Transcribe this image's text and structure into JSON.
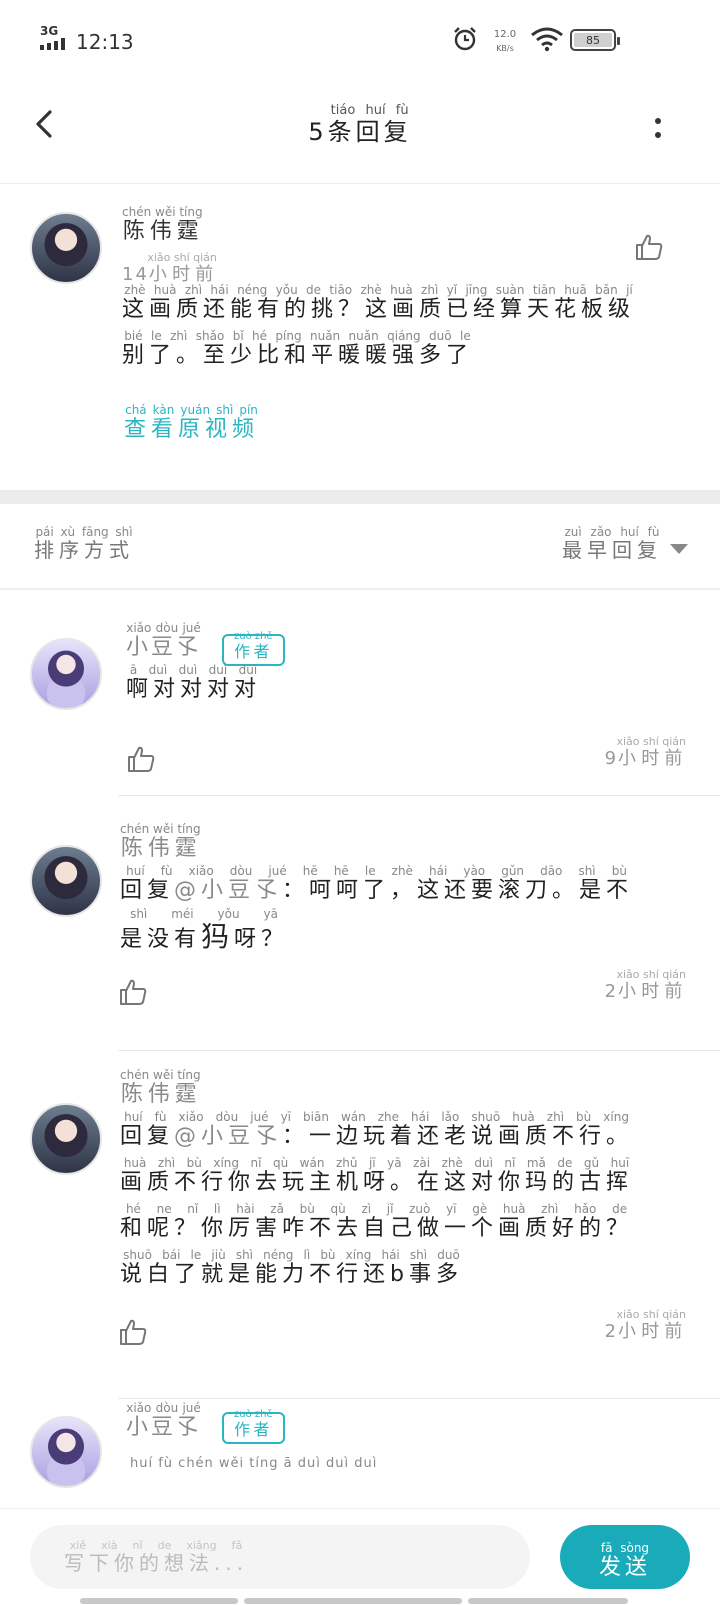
{
  "status_bar": {
    "network": "3G",
    "time": "12:13",
    "speed_value": "12.0",
    "speed_unit": "KB/s",
    "battery": "85"
  },
  "header": {
    "title_num": "5",
    "title_pinyin": "tiáo huí fù",
    "title_text": "条回复"
  },
  "main_comment": {
    "user_pinyin": "chén wěi tíng",
    "user_name": "陈伟霆",
    "time_pinyin": "xiǎo shí qián",
    "time_num": "14",
    "time_text": "小时前",
    "text_lines": [
      {
        "pinyin": "zhè huà zhì hái néng yǒu de tiāo    zhè huà zhì yǐ jīng suàn tiān huā bǎn jí",
        "text": "这画质还能有的挑？这画质已经算天花板级"
      },
      {
        "pinyin": "bié le    zhì shǎo bǐ hé píng nuǎn nuǎn qiáng duō le",
        "text": "别了。至少比和平暖暖强多了"
      }
    ],
    "view_video_pinyin": "chá kàn yuán shì pín",
    "view_video_text": "查看原视频"
  },
  "sort": {
    "label_pinyin": "pái xù fāng shì",
    "label_text": "排序方式",
    "value_pinyin": "zuì zǎo huí fù",
    "value_text": "最早回复"
  },
  "replies": [
    {
      "user_pinyin": "xiǎo dòu jué",
      "user_name": "小豆孓",
      "badge_pinyin": "zuò zhě",
      "badge_text": "作者",
      "line1_pinyin": "ā duì duì duì duì",
      "line1_text": "啊对对对对",
      "time_pinyin": "xiǎo shí qián",
      "time_num": "9",
      "time_text": "小时前"
    },
    {
      "user_pinyin": "chén wěi tíng",
      "user_name": "陈伟霆",
      "line1_pinyin": "huí fù    xiǎo dòu jué      hē hē le      zhè hái yào gǔn dāo      shì bù",
      "line1_prefix": "回复",
      "line1_mention": "@小豆孓",
      "line1_text": "：呵呵了，这还要滚刀。是不",
      "line2_pinyin": "shì méi yǒu      yā",
      "line2_text_a": "是没有",
      "line2_big": "犸",
      "line2_text_b": "呀？",
      "time_pinyin": "xiǎo shí qián",
      "time_num": "2",
      "time_text": "小时前"
    },
    {
      "user_pinyin": "chén wěi tíng",
      "user_name": "陈伟霆",
      "line1_pinyin": "huí fù    xiǎo dòu jué      yī biān wán zhe hái lǎo shuō huà zhì bù xíng",
      "line1_prefix": "回复",
      "line1_mention": "@小豆孓",
      "line1_text": "：一边玩着还老说画质不行。",
      "line2_pinyin": "huà zhì bù xíng nǐ qù wán zhǔ jī yā    zài zhè duì nǐ mǎ de gǔ huī",
      "line2_text": "画质不行你去玩主机呀。在这对你玛的古挥",
      "line3_pinyin": "hé ne    nǐ lì hài zǎ bù qù zì jǐ zuò yī gè huà zhì hǎo de",
      "line3_text": "和呢？你厉害咋不去自己做一个画质好的？",
      "line4_pinyin": "shuō bái le jiù shì néng lì bù xíng hái    shì duō",
      "line4_text": "说白了就是能力不行还b事多",
      "time_pinyin": "xiǎo shí qián",
      "time_num": "2",
      "time_text": "小时前"
    },
    {
      "user_pinyin": "xiǎo dòu jué",
      "user_name": "小豆孓",
      "badge_pinyin": "zuò zhě",
      "badge_text": "作者",
      "line1_pinyin": "huí fù    chén wěi tíng      ā duì duì duì"
    }
  ],
  "input": {
    "placeholder_pinyin": "xiě xià nǐ de xiǎng fǎ",
    "placeholder_text": "写下你的想法..."
  },
  "send": {
    "pinyin": "fā sòng",
    "text": "发送"
  }
}
